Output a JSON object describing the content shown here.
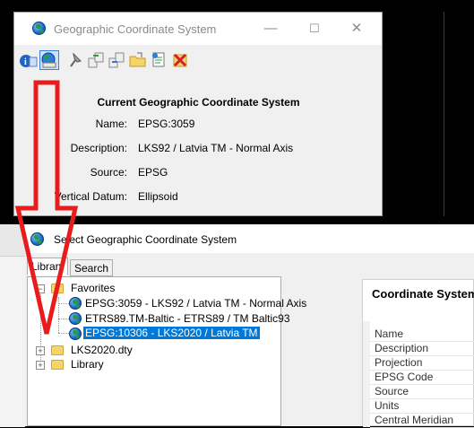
{
  "window1": {
    "title": "Geographic Coordinate System",
    "controls": {
      "minimize": "—",
      "maximize": "☐",
      "close": "✕"
    },
    "toolbar_icons": [
      "info-icon",
      "globe-icon",
      "pin-icon",
      "transfer-icon",
      "transfer2-icon",
      "folder-open-icon",
      "document-icon",
      "delete-icon"
    ],
    "info": {
      "heading": "Current Geographic Coordinate System",
      "rows": [
        {
          "label": "Name:",
          "value": "EPSG:3059"
        },
        {
          "label": "Description:",
          "value": "LKS92 / Latvia TM - Normal Axis"
        },
        {
          "label": "Source:",
          "value": "EPSG"
        },
        {
          "label": "Vertical Datum:",
          "value": "Ellipsoid"
        }
      ]
    }
  },
  "window2": {
    "title": "Select Geographic Coordinate System",
    "tabs": [
      {
        "label": "Library"
      },
      {
        "label": "Search"
      }
    ],
    "tree": {
      "favorites": "Favorites",
      "fav_items": [
        "EPSG:3059 - LKS92 / Latvia TM - Normal Axis",
        "ETRS89.TM-Baltic - ETRS89 / TM Baltic93",
        "EPSG:10306 - LKS2020 / Latvia TM"
      ],
      "other_items": [
        "LKS2020.dty",
        "Library"
      ]
    },
    "panel": {
      "heading": "Coordinate System",
      "props": [
        "Name",
        "Description",
        "Projection",
        "EPSG Code",
        "Source",
        "Units",
        "Central Meridian"
      ]
    }
  },
  "colors": {
    "arrow": "#e81c1c",
    "selection": "#0078d7"
  }
}
